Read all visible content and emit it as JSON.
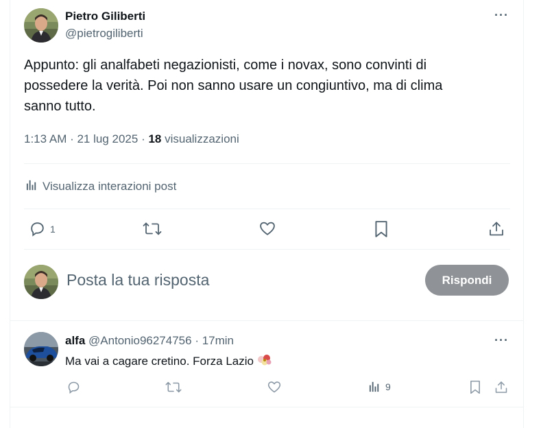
{
  "post": {
    "author_name": "Pietro Giliberti",
    "author_handle": "@pietrogiliberti",
    "text_line1": "Appunto: gli analfabeti negazionisti, come i novax, sono convinti di",
    "text_line2": "possedere la verità. Poi non sanno usare un congiuntivo, ma di clima",
    "text_line3": "sanno tutto.",
    "time": "1:13 AM · 21 lug 2025 · ",
    "views_count": "18",
    "views_label": " visualizzazioni",
    "analytics_label": "Visualizza interazioni post",
    "reply_count": "1"
  },
  "composer": {
    "placeholder": "Posta la tua risposta",
    "button_label": "Rispondi"
  },
  "reply": {
    "name": "alfa",
    "handle": "@Antonio96274756",
    "time": " · 17min",
    "text": "Ma vai a cagare cretino. Forza Lazio",
    "views_count": "9"
  },
  "icons": {
    "more": "more-horizontal-icon",
    "reply": "comment-icon",
    "repost": "repost-icon",
    "like": "heart-icon",
    "bookmark": "bookmark-icon",
    "share": "share-icon",
    "analytics": "bar-chart-icon"
  },
  "colors": {
    "text_primary": "#0f1419",
    "text_secondary": "#536471",
    "divider": "#eff3f4",
    "button_disabled": "#8f9296"
  }
}
